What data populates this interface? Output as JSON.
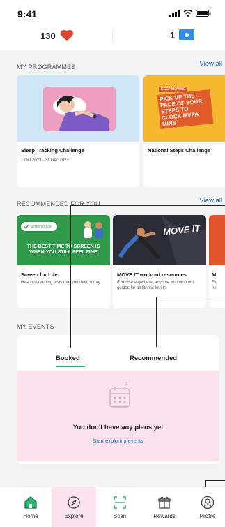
{
  "status_bar": {
    "time": "9:41"
  },
  "points": {
    "hearts": "130",
    "steps": "1"
  },
  "programmes": {
    "title": "MY PROGRAMMES",
    "view_all": "View all",
    "cards": [
      {
        "title": "Sleep Tracking Challenge",
        "subtitle": "1 Oct 2023 - 31 Dec 2023"
      },
      {
        "title": "National Steps Challenge",
        "banner_small": "KEEP MOVING",
        "banner_text": "PICK UP THE PACE OF YOUR STEPS TO CLOCK MVPA MINS"
      }
    ]
  },
  "recommended": {
    "title": "RECOMMENDED FOR YOU",
    "view_all": "View all",
    "cards": [
      {
        "title": "Screen for Life",
        "subtitle": "Health screening tests that you need today",
        "logo": "ScreenforLife",
        "banner": "THE BEST TIME TO SCREEN IS WHEN YOU STILL FEEL FINE"
      },
      {
        "title": "MOVE IT workout resources",
        "subtitle": "Exercise anywhere, anytime with workout guides for all fitness levels",
        "banner": "MOVE IT"
      },
      {
        "title": "M",
        "subtitle": "Fir ne"
      }
    ]
  },
  "events": {
    "title": "MY EVENTS",
    "tabs": [
      {
        "label": "Booked"
      },
      {
        "label": "Recommended"
      }
    ],
    "empty_message": "You don't have any plans yet",
    "empty_cta": "Start exploring events"
  },
  "nav": {
    "items": [
      {
        "label": "Home"
      },
      {
        "label": "Explore"
      },
      {
        "label": "Scan"
      },
      {
        "label": "Rewards"
      },
      {
        "label": "Profile"
      }
    ]
  },
  "colors": {
    "accent_green": "#2bb673",
    "link_blue": "#1f6fd6",
    "heart_red": "#e2452c",
    "highlight_pink": "#fbe2ec"
  }
}
